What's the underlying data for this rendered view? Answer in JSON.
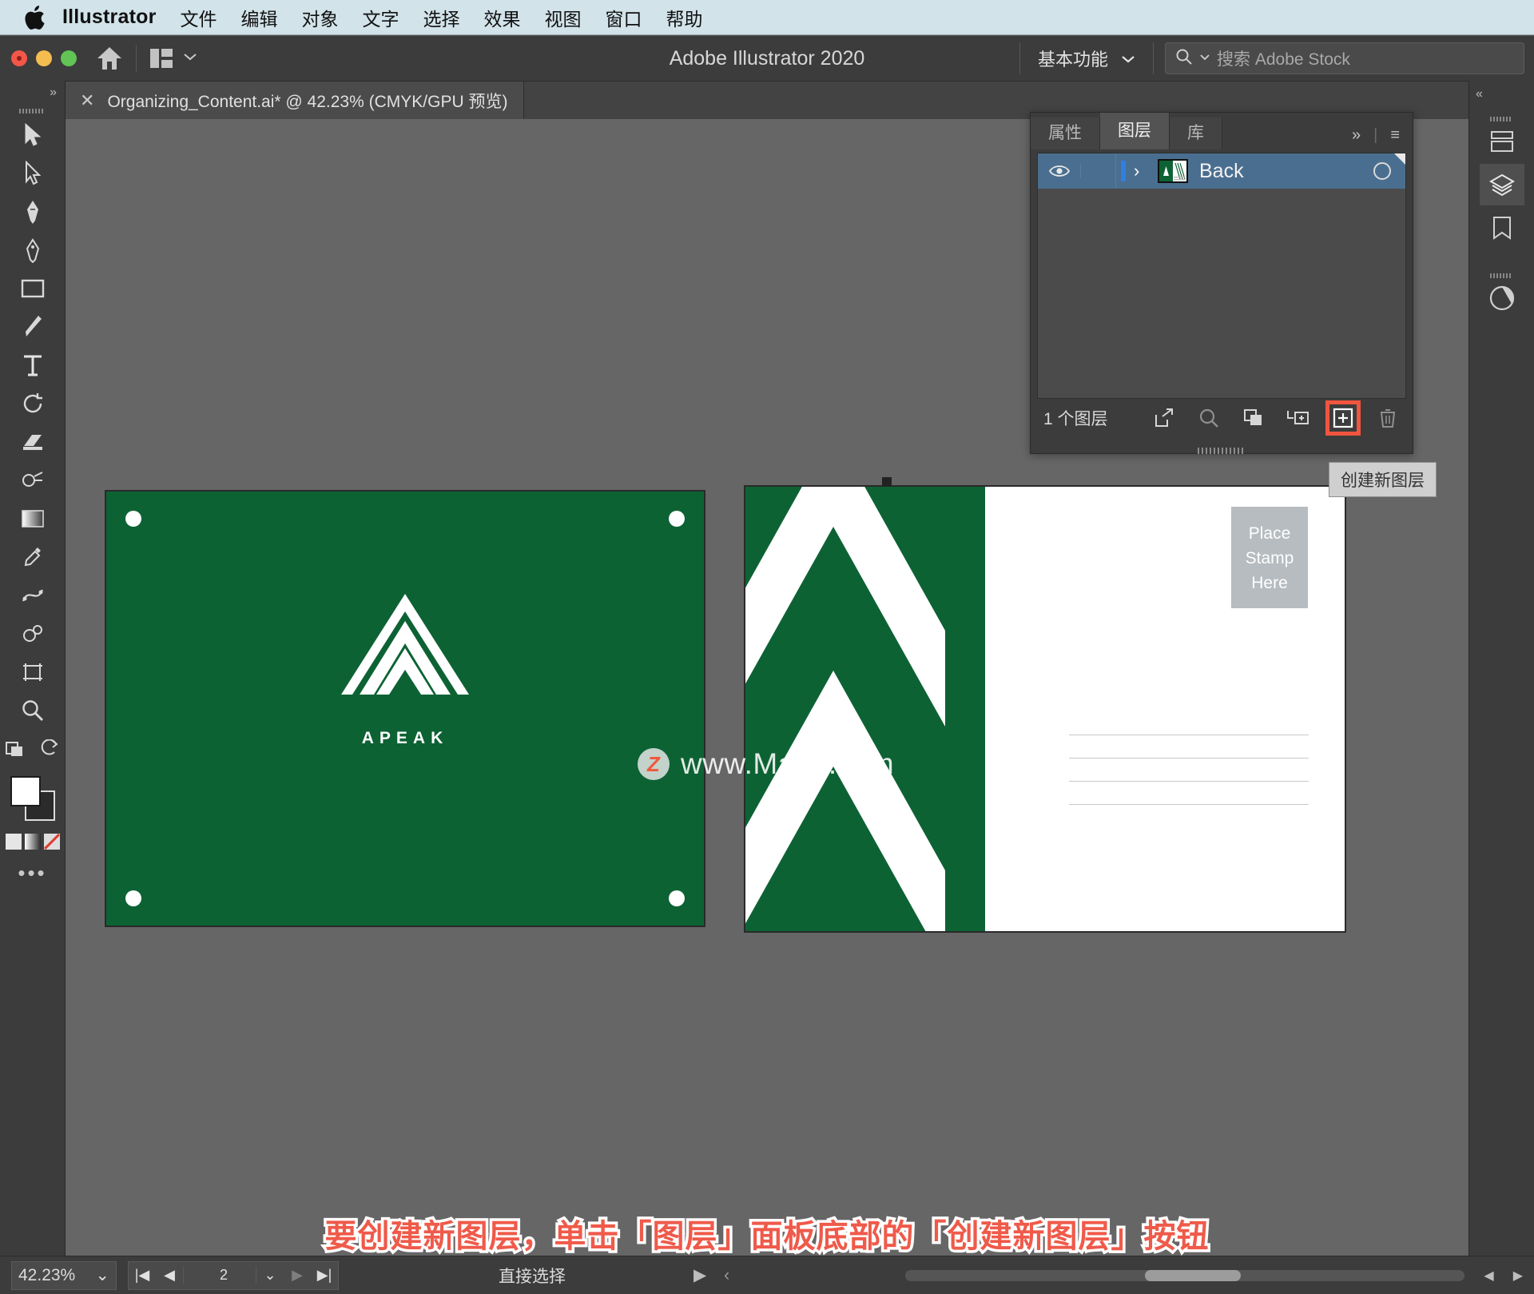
{
  "macmenu": {
    "app_name": "Illustrator",
    "items": [
      "文件",
      "编辑",
      "对象",
      "文字",
      "选择",
      "效果",
      "视图",
      "窗口",
      "帮助"
    ]
  },
  "titlebar": {
    "title": "Adobe Illustrator 2020",
    "workspace": "基本功能",
    "search_placeholder": "搜索 Adobe Stock"
  },
  "tab": {
    "close": "✕",
    "label": "Organizing_Content.ai* @ 42.23% (CMYK/GPU 预览)"
  },
  "layers_panel": {
    "tabs": [
      {
        "label": "属性",
        "active": false
      },
      {
        "label": "图层",
        "active": true
      },
      {
        "label": "库",
        "active": false
      }
    ],
    "expand_icon": "»",
    "menu_icon": "≡",
    "rows": [
      {
        "name": "Back",
        "visible": true,
        "locked": false,
        "expand": "›",
        "selected": true
      }
    ],
    "footer_count": "1 个图层",
    "footer_buttons": [
      "release-to-layers-icon",
      "locate-object-icon",
      "make-clipping-mask-icon",
      "create-new-sublayer-icon",
      "create-new-layer-icon",
      "delete-selection-icon"
    ],
    "tooltip": "创建新图层"
  },
  "artboard_front": {
    "brand": "APEAK",
    "bg_color": "#0d6234",
    "mark_color": "#ffffff"
  },
  "artboard_back": {
    "stamp_text": "Place\nStamp\nHere",
    "stamp_line1": "Place",
    "stamp_line2": "Stamp",
    "stamp_line3": "Here",
    "bg_color": "#ffffff",
    "chevron_color": "#0d6234"
  },
  "watermark": {
    "badge": "Z",
    "text": "www.MacZ.com"
  },
  "caption": {
    "text": "要创建新图层，单击「图层」面板底部的「创建新图层」按钮",
    "color": "#ef5a4a"
  },
  "statusbar": {
    "zoom": "42.23%",
    "zoom_chevron": "⌄",
    "artboard_first": "|◀",
    "artboard_prev": "◀",
    "artboard_number": "2",
    "artboard_chevron": "⌄",
    "artboard_next": "▶",
    "artboard_last": "▶|",
    "tool_status": "直接选择",
    "status_play": "▶",
    "status_chevron": "‹"
  },
  "right_dock": {
    "collapse": "«",
    "icons": [
      "properties-icon",
      "layers-icon",
      "libraries-icon",
      "color-guide-icon"
    ]
  },
  "toolbar": {
    "collapse": "»",
    "tools": [
      "selection-tool",
      "direct-selection-tool",
      "pen-tool",
      "curvature-tool",
      "rectangle-tool",
      "paintbrush-tool",
      "type-tool",
      "rotate-tool",
      "eraser-tool",
      "shape-builder-tool",
      "gradient-tool",
      "eyedropper-tool",
      "blend-tool",
      "symbol-sprayer-tool",
      "artboard-tool",
      "zoom-tool"
    ],
    "fill_color": "#ffffff",
    "stroke_color": "#2b2b2b"
  }
}
